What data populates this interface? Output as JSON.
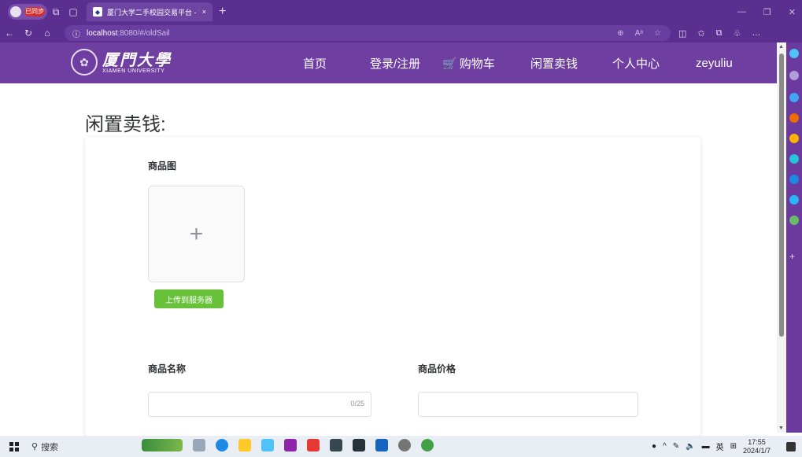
{
  "browser": {
    "profile_badge": "已同步",
    "tab_title": "厦门大学二手校园交易平台 - 首页",
    "url_host": "localhost",
    "url_path": ":8080/#/oldSail"
  },
  "site": {
    "logo_cn": "厦門大學",
    "logo_en": "XIAMEN UNIVERSITY",
    "nav": [
      {
        "label": "首页"
      },
      {
        "label": "登录/注册"
      },
      {
        "label": "购物车"
      },
      {
        "label": "闲置卖钱"
      },
      {
        "label": "个人中心"
      },
      {
        "label": "zeyuliu"
      }
    ]
  },
  "page": {
    "heading": "闲置卖钱:",
    "image_label": "商品图",
    "upload_plus": "+",
    "upload_button": "上传到服务器",
    "name_label": "商品名称",
    "name_value": "",
    "name_counter": "0/25",
    "price_label": "商品价格",
    "price_value": ""
  },
  "taskbar": {
    "search_label": "搜索",
    "ime": "英",
    "time": "17:55",
    "date": "2024/1/7"
  }
}
